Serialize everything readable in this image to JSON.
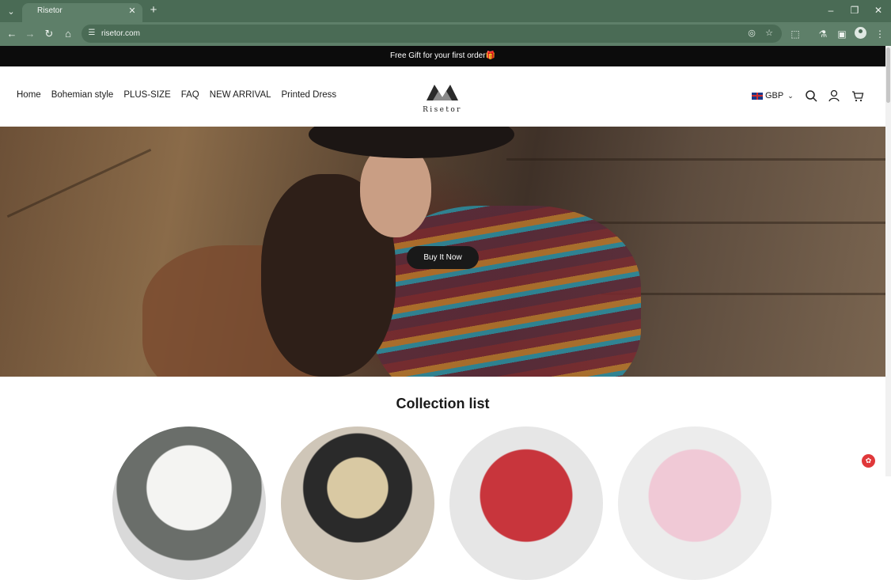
{
  "browser": {
    "tab_title": "Risetor",
    "url": "risetor.com"
  },
  "page": {
    "announcement": "Free Gift for your first order🎁",
    "nav": [
      "Home",
      "Bohemian style",
      "PLUS-SIZE",
      "FAQ",
      "NEW ARRIVAL",
      "Printed Dress"
    ],
    "logo_text": "Risetor",
    "currency": "GBP",
    "hero_button": "Buy It Now",
    "collection_title": "Collection list"
  },
  "colors": {
    "chrome": "#4a6b55",
    "announcement_bg": "#0c0c0c",
    "button_bg": "#191919"
  }
}
